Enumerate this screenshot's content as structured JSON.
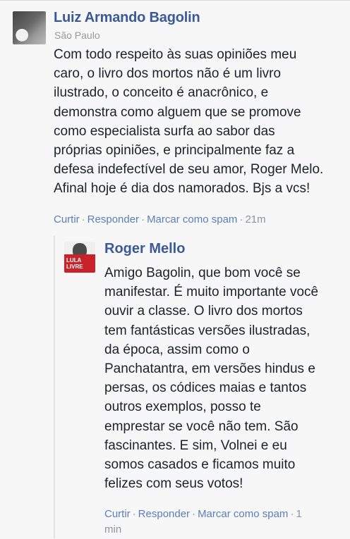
{
  "comment": {
    "author": "Luiz Armando Bagolin",
    "location": "São Paulo",
    "lines": [
      "Com todo respeito às suas opiniões meu",
      "caro, o livro dos mortos não é um livro",
      "ilustrado, o conceito é anacrônico, e",
      "demonstra como alguem que se promove",
      "como especialista surfa ao sabor das",
      "próprias opiniões, e principalmente faz a",
      "defesa indefectível de seu amor, Roger Melo.",
      "Afinal hoje é dia dos namorados. Bjs a vcs!"
    ],
    "actions": {
      "like": "Curtir",
      "reply": "Responder",
      "spam": "Marcar como spam",
      "time": "21m"
    }
  },
  "reply": {
    "author": "Roger Mello",
    "avatar_text": "LULA LIVRE",
    "lines": [
      "Amigo Bagolin, que bom você se",
      "manifestar. É muito importante você",
      "ouvir a classe. O livro dos mortos",
      "tem fantásticas versões ilustradas,",
      "da época, assim como o",
      "Panchatantra, em versões hindus e",
      "persas, os códices maias e tantos",
      "outros exemplos, posso te",
      "emprestar se você não tem. São",
      "fascinantes. E sim, Volnei e eu",
      "somos casados e ficamos muito",
      "felizes com seus votos!"
    ],
    "actions": {
      "like": "Curtir",
      "reply": "Responder",
      "spam": "Marcar como spam",
      "time_part1": "1",
      "time_part2": "min"
    }
  },
  "colors": {
    "author": "#3b5998",
    "action_link": "#5a7fb8",
    "meta": "#8d949e",
    "background": "#f7f7f7"
  }
}
